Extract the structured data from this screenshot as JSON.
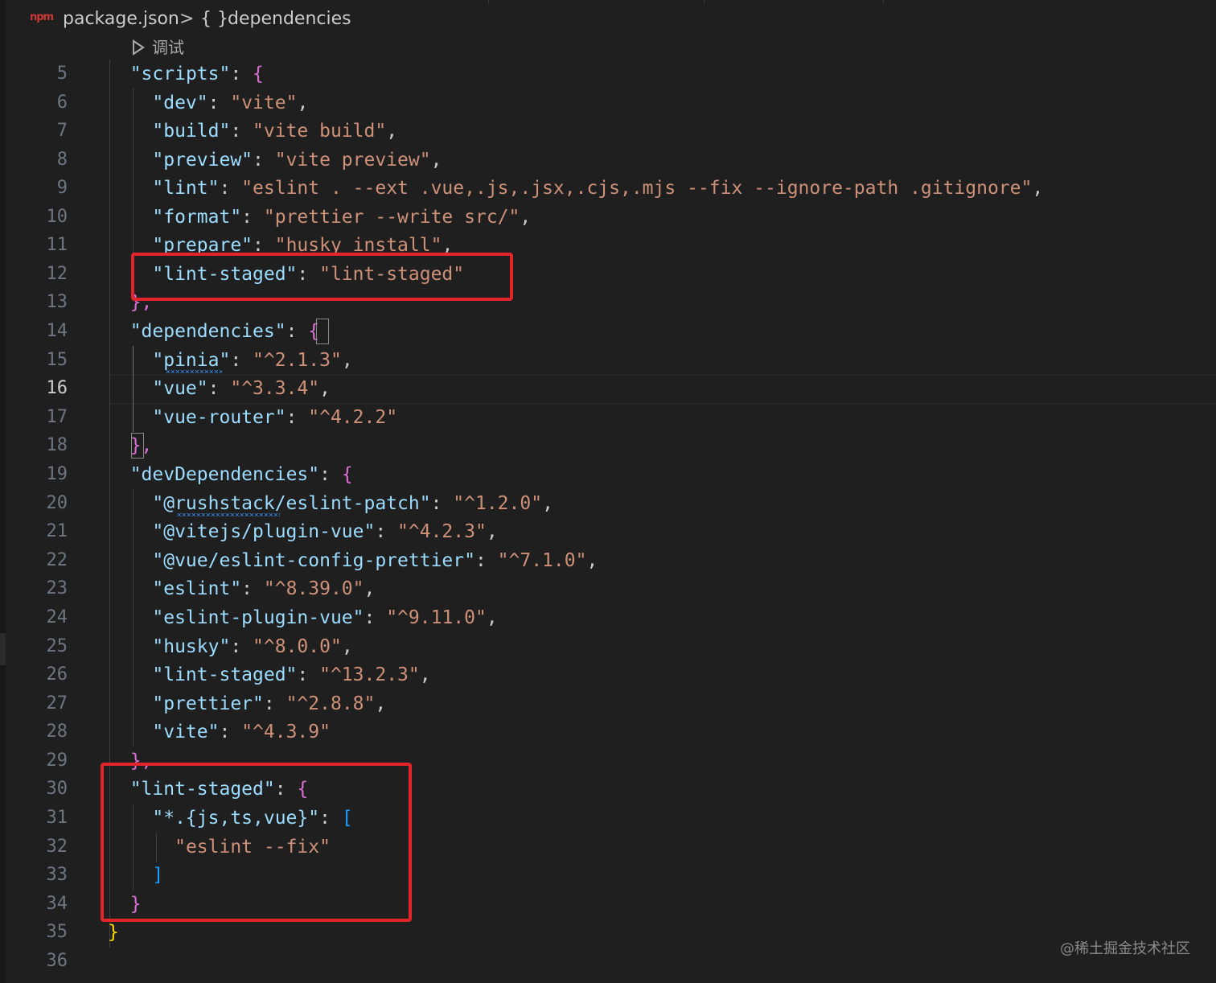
{
  "breadcrumb": {
    "file_icon": "npm-icon",
    "file_icon_text": "npm",
    "file": "package.json",
    "separator": ">",
    "symbol_icon": "{ }",
    "symbol": "dependencies"
  },
  "codelens": {
    "icon": "play-icon",
    "label": "调试"
  },
  "active_line": "16",
  "line_numbers": [
    "5",
    "6",
    "7",
    "8",
    "9",
    "10",
    "11",
    "12",
    "13",
    "14",
    "15",
    "16",
    "17",
    "18",
    "19",
    "20",
    "21",
    "22",
    "23",
    "24",
    "25",
    "26",
    "27",
    "28",
    "29",
    "30",
    "31",
    "32",
    "33",
    "34",
    "35",
    "36"
  ],
  "code": {
    "scripts": {
      "key": "\"scripts\"",
      "open": "{",
      "close": "},",
      "entries": [
        {
          "key": "\"dev\"",
          "value": "\"vite\"",
          "sep": ","
        },
        {
          "key": "\"build\"",
          "value": "\"vite build\"",
          "sep": ","
        },
        {
          "key": "\"preview\"",
          "value": "\"vite preview\"",
          "sep": ","
        },
        {
          "key": "\"lint\"",
          "value": "\"eslint . --ext .vue,.js,.jsx,.cjs,.mjs --fix --ignore-path .gitignore\"",
          "sep": ","
        },
        {
          "key": "\"format\"",
          "value": "\"prettier --write src/\"",
          "sep": ","
        },
        {
          "key": "\"prepare\"",
          "value": "\"husky install\"",
          "sep": ","
        },
        {
          "key": "\"lint-staged\"",
          "value": "\"lint-staged\"",
          "sep": ""
        }
      ]
    },
    "dependencies": {
      "key": "\"dependencies\"",
      "open": "{",
      "close": "},",
      "entries": [
        {
          "key": "\"pinia\"",
          "value": "\"^2.1.3\"",
          "sep": ","
        },
        {
          "key": "\"vue\"",
          "value": "\"^3.3.4\"",
          "sep": ","
        },
        {
          "key": "\"vue-router\"",
          "value": "\"^4.2.2\"",
          "sep": ""
        }
      ]
    },
    "devDependencies": {
      "key": "\"devDependencies\"",
      "open": "{",
      "close": "},",
      "entries": [
        {
          "key": "\"@rushstack/eslint-patch\"",
          "value": "\"^1.2.0\"",
          "sep": ","
        },
        {
          "key": "\"@vitejs/plugin-vue\"",
          "value": "\"^4.2.3\"",
          "sep": ","
        },
        {
          "key": "\"@vue/eslint-config-prettier\"",
          "value": "\"^7.1.0\"",
          "sep": ","
        },
        {
          "key": "\"eslint\"",
          "value": "\"^8.39.0\"",
          "sep": ","
        },
        {
          "key": "\"eslint-plugin-vue\"",
          "value": "\"^9.11.0\"",
          "sep": ","
        },
        {
          "key": "\"husky\"",
          "value": "\"^8.0.0\"",
          "sep": ","
        },
        {
          "key": "\"lint-staged\"",
          "value": "\"^13.2.3\"",
          "sep": ","
        },
        {
          "key": "\"prettier\"",
          "value": "\"^2.8.8\"",
          "sep": ","
        },
        {
          "key": "\"vite\"",
          "value": "\"^4.3.9\"",
          "sep": ""
        }
      ]
    },
    "lint_staged": {
      "key": "\"lint-staged\"",
      "open": "{",
      "close": "}",
      "pattern_key": "\"*.{js,ts,vue}\"",
      "array_open": "[",
      "array_close": "]",
      "command": "\"eslint --fix\""
    },
    "root_close": "}"
  },
  "colon": ": ",
  "watermark": "@稀土掘金技术社区",
  "colors": {
    "background": "#1f1f1f",
    "key": "#9cdcfe",
    "string": "#ce9178",
    "bracket_level1": "#ffd700",
    "bracket_level2": "#da70d6",
    "bracket_level3": "#179fff",
    "annotation_box": "#e3242b"
  }
}
